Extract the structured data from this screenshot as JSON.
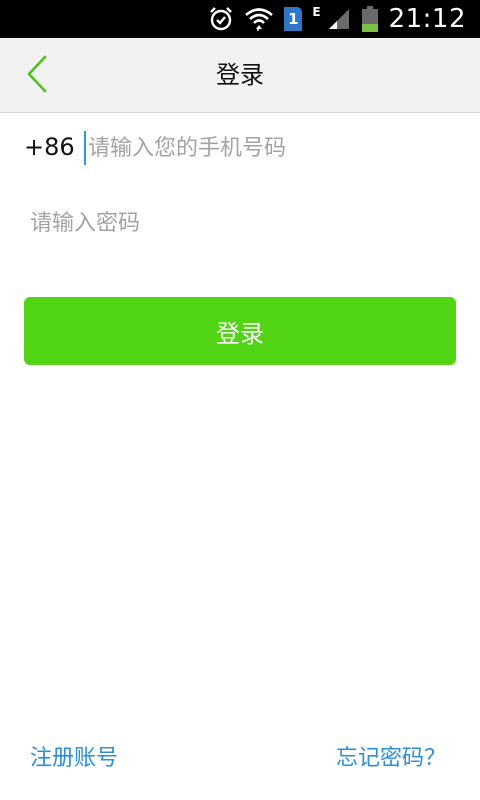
{
  "status_bar": {
    "time": "21:12",
    "sim_slot": "1",
    "network_type": "E",
    "icons": [
      "alarm-icon",
      "wifi-icon",
      "sim-icon",
      "signal-icon",
      "battery-icon"
    ]
  },
  "header": {
    "title": "登录",
    "back_icon": "chevron-left-icon"
  },
  "form": {
    "country_code": "+86",
    "phone_placeholder": "请输入您的手机号码",
    "phone_value": "",
    "password_placeholder": "请输入密码",
    "password_value": "",
    "login_label": "登录"
  },
  "footer": {
    "register_label": "注册账号",
    "forgot_label": "忘记密码？"
  },
  "colors": {
    "accent_green": "#50d414",
    "link_blue": "#2b8fd8",
    "cursor_blue": "#2b9cd8",
    "title_bar_bg": "#f2f2f2"
  }
}
